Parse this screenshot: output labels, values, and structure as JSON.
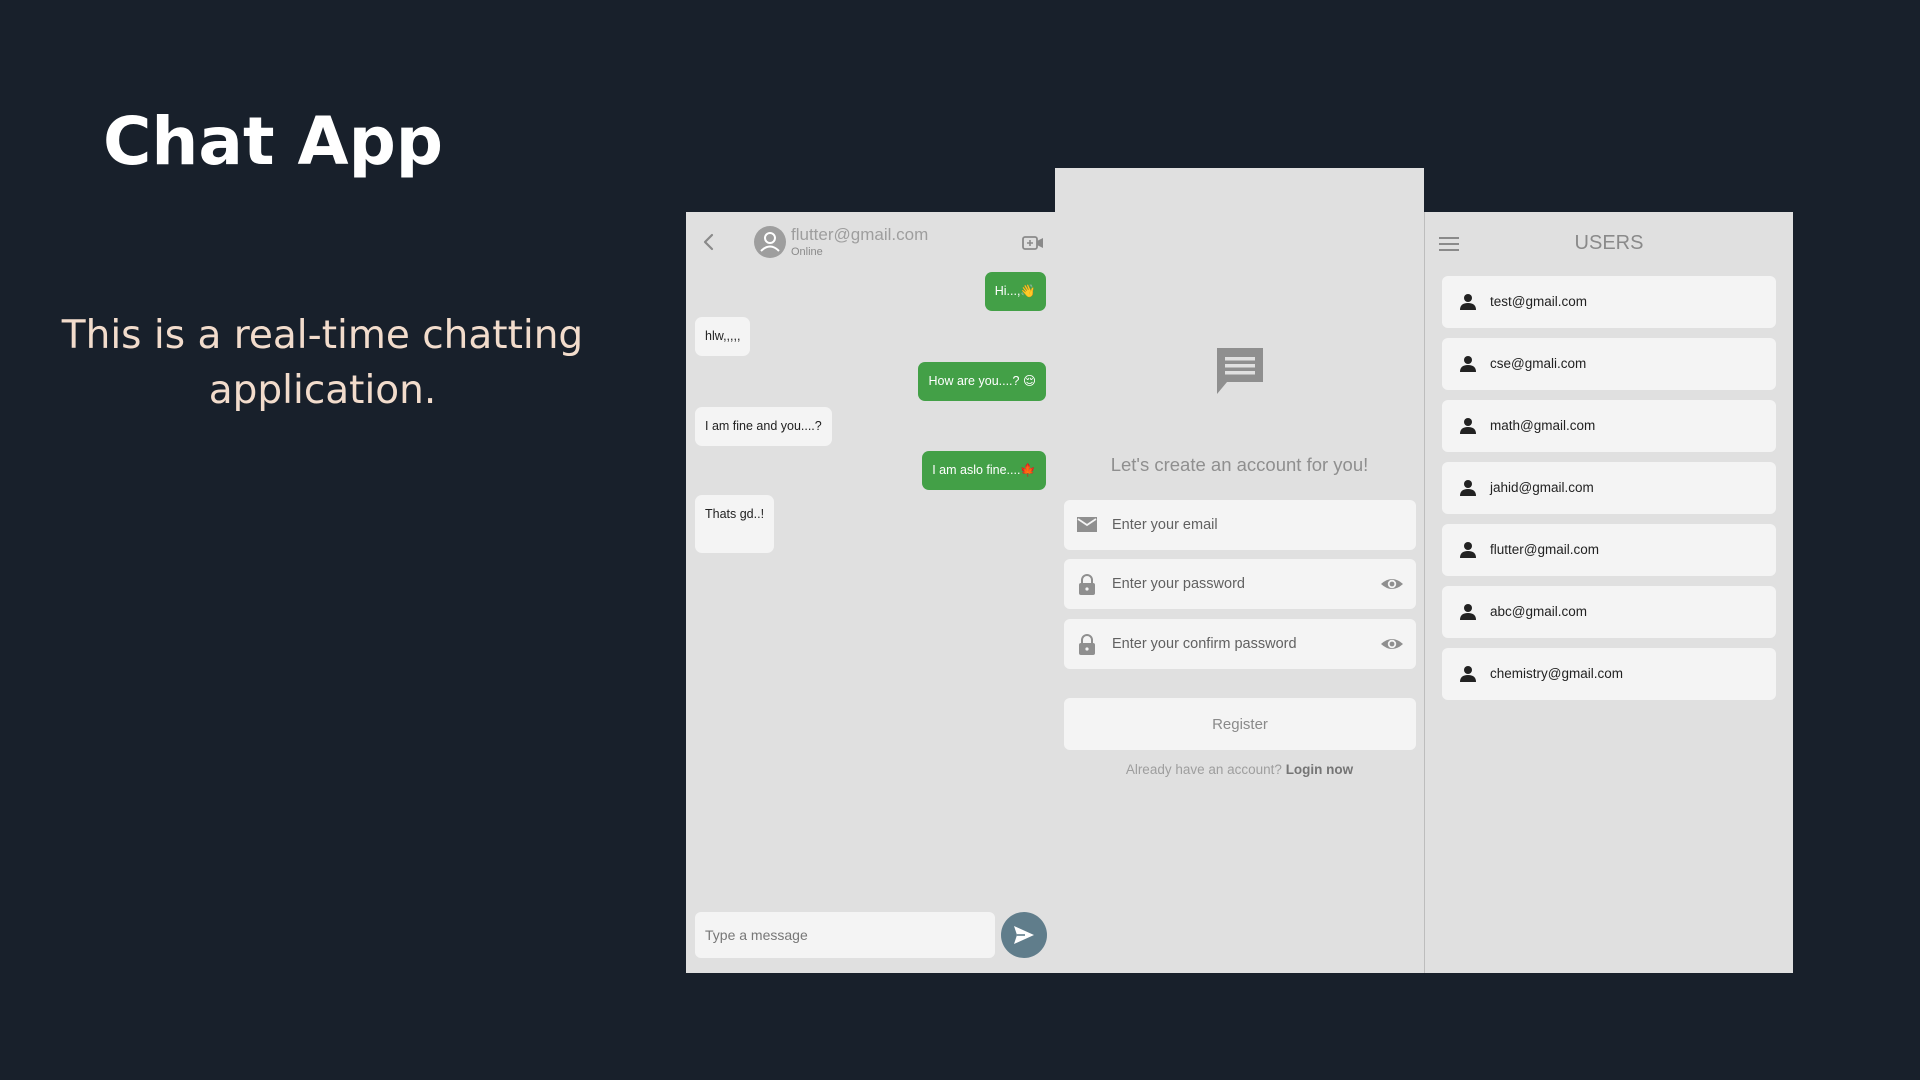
{
  "slide": {
    "title": "Chat App",
    "description": "This is a real-time chatting application."
  },
  "chat": {
    "peer_name": "flutter@gmail.com",
    "peer_status": "Online",
    "messages": [
      {
        "from": "me",
        "text": "Hi...,👋"
      },
      {
        "from": "peer",
        "text": "hlw,,,,,"
      },
      {
        "from": "me",
        "text": "How are you....? 😌"
      },
      {
        "from": "peer",
        "text": "I am fine and you....?"
      },
      {
        "from": "me",
        "text": "I am aslo fine....🍁"
      },
      {
        "from": "peer",
        "text": "Thats gd..!"
      }
    ],
    "composer_placeholder": "Type a message",
    "colors": {
      "sent_bubble": "#43a047",
      "received_bubble": "#f4f4f4",
      "send_button": "#607d8b"
    },
    "icons": {
      "back": "chevron-left-icon",
      "avatar": "person-icon",
      "video": "video-call-icon",
      "send": "send-icon"
    }
  },
  "register": {
    "heading": "Let's create an account for you!",
    "email_placeholder": "Enter your email",
    "password_placeholder": "Enter your password",
    "confirm_password_placeholder": "Enter your confirm password",
    "register_label": "Register",
    "login_prompt": "Already have an account?",
    "login_link": "Login now",
    "icons": {
      "logo": "chat-bubble-icon",
      "email": "mail-icon",
      "password": "lock-icon",
      "toggle": "eye-icon"
    }
  },
  "users": {
    "title": "USERS",
    "items": [
      {
        "email": "test@gmail.com"
      },
      {
        "email": "cse@gmali.com"
      },
      {
        "email": "math@gmail.com"
      },
      {
        "email": "jahid@gmail.com"
      },
      {
        "email": "flutter@gmail.com"
      },
      {
        "email": "abc@gmail.com"
      },
      {
        "email": "chemistry@gmail.com"
      }
    ],
    "icons": {
      "menu": "menu-icon",
      "user": "person-icon"
    }
  },
  "theme": {
    "background": "#18202b",
    "title_color": "#ffffff",
    "description_color": "#f2dccc",
    "screen_background": "#e0e0e0"
  }
}
